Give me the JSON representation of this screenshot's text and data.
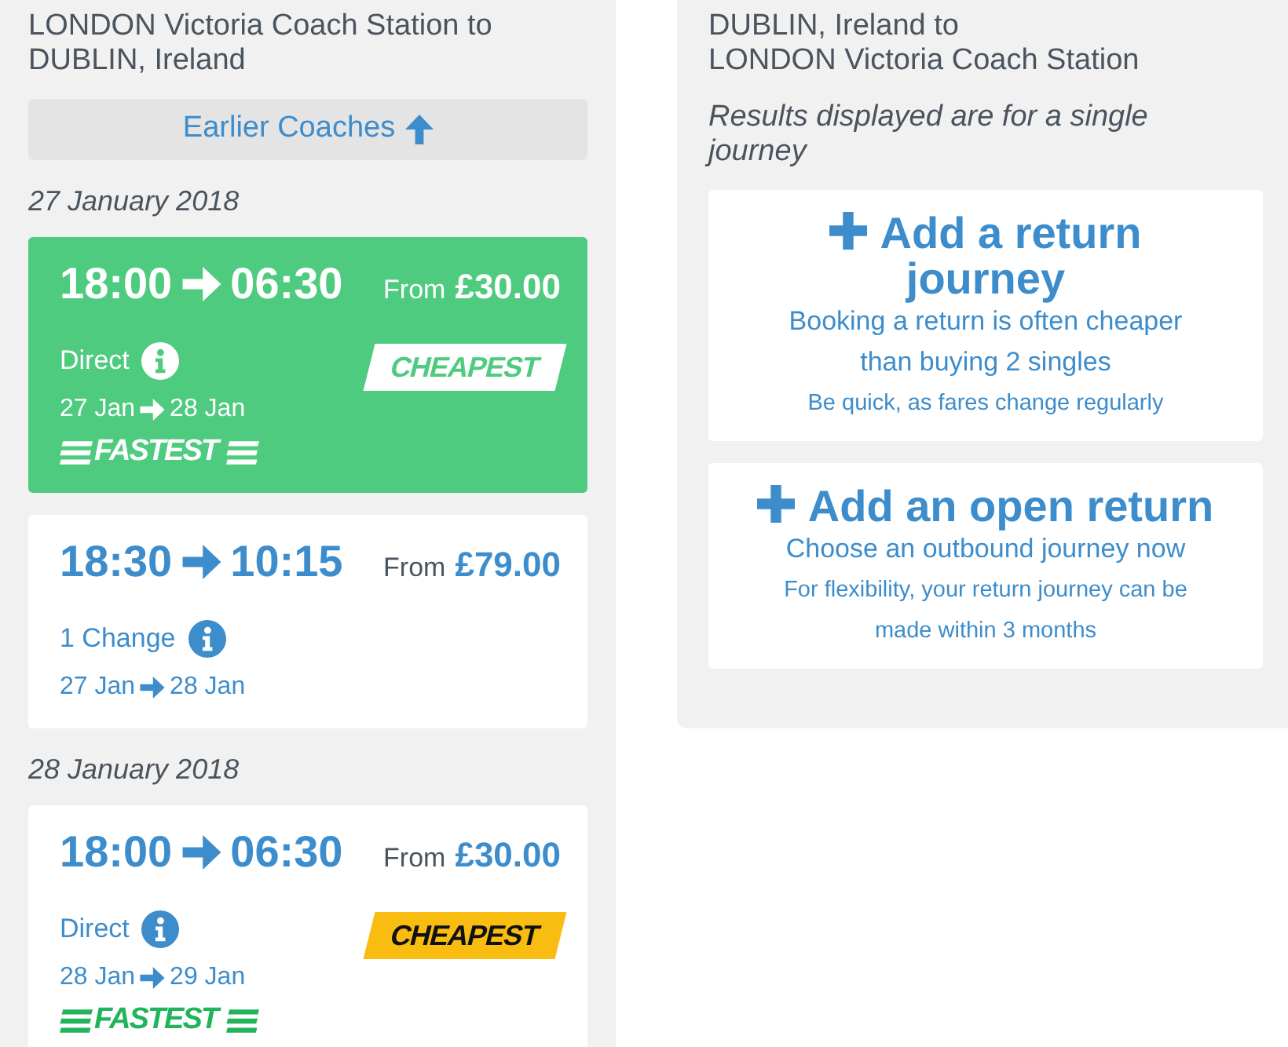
{
  "outbound": {
    "title_lines": [
      "LONDON Victoria Coach Station to",
      "DUBLIN, Ireland"
    ],
    "earlier_button": "Earlier Coaches",
    "days": [
      {
        "date": "27 January 2018",
        "journeys": [
          {
            "selected": true,
            "depart": "18:00",
            "arrive": "06:30",
            "from_label": "From",
            "price": "£30.00",
            "changes": "Direct",
            "date_from": "27 Jan",
            "date_to": "28 Jan",
            "badges": [
              {
                "kind": "cheapest",
                "label": "CHEAPEST"
              },
              {
                "kind": "fastest",
                "label": "FASTEST"
              }
            ]
          },
          {
            "selected": false,
            "depart": "18:30",
            "arrive": "10:15",
            "from_label": "From",
            "price": "£79.00",
            "changes": "1 Change",
            "date_from": "27 Jan",
            "date_to": "28 Jan"
          }
        ]
      },
      {
        "date": "28 January 2018",
        "journeys": [
          {
            "selected": false,
            "depart": "18:00",
            "arrive": "06:30",
            "from_label": "From",
            "price": "£30.00",
            "changes": "Direct",
            "date_from": "28 Jan",
            "date_to": "29 Jan",
            "badges": [
              {
                "kind": "cheapest",
                "label": "CHEAPEST"
              },
              {
                "kind": "fastest",
                "label": "FASTEST"
              }
            ]
          }
        ]
      }
    ]
  },
  "return_search": {
    "title_lines": [
      "DUBLIN, Ireland to",
      "LONDON Victoria Coach Station"
    ],
    "note": "Results displayed are for a single journey",
    "options": [
      {
        "title": "Add a return journey",
        "description": "Booking a return is often cheaper than buying 2 singles",
        "hint": "Be quick, as fares change regularly"
      },
      {
        "title": "Add an open return",
        "description": "Choose an outbound journey now",
        "hint": "For flexibility, your return journey can be made within 3 months"
      }
    ]
  }
}
